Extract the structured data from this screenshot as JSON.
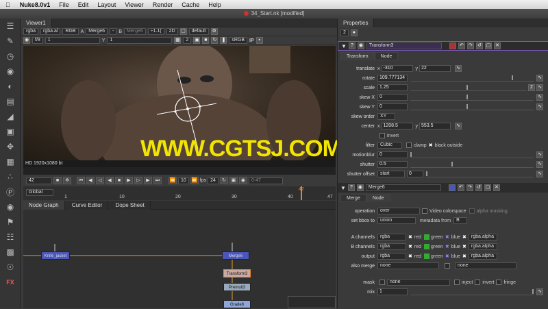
{
  "menubar": {
    "app": "Nuke8.0v1",
    "items": [
      "File",
      "Edit",
      "Layout",
      "Viewer",
      "Render",
      "Cache",
      "Help"
    ]
  },
  "window": {
    "title": "34_Start.nk [modified]"
  },
  "viewer": {
    "tab": "Viewer1",
    "channels": "rgba",
    "channel2": "rgba.al",
    "layer": "RGB",
    "a_label": "A",
    "a_input": "Merge6",
    "compare": "-",
    "b_label": "B",
    "b_input": "Merge6",
    "zoom": "÷1.1(",
    "view": "2D",
    "lut_default": "default",
    "fstop": "f/8",
    "gain": "1",
    "y_label": "Y",
    "gamma": "1",
    "proxy": "2",
    "colorspace": "sRGB",
    "ip": "IP",
    "format": "HD 1920x1080 bt",
    "frame": "42",
    "fps_label": "fps",
    "fps": "24",
    "step": "10",
    "range": "0-47",
    "frame_mark": "42",
    "tl_ticks": [
      "1",
      "10",
      "20",
      "30",
      "40",
      "47"
    ],
    "scope": "Global"
  },
  "watermark": "WWW.CGTSJ.COM",
  "graph": {
    "tabs": [
      "Node Graph",
      "Curve Editor",
      "Dope Sheet"
    ],
    "nodes": {
      "left": "Knife_jacket",
      "merge": "Merge6",
      "transform": "Transform3",
      "premult": "Premult3",
      "grade": "Grade8"
    }
  },
  "properties": {
    "title": "Properties",
    "count": "2",
    "transform": {
      "name": "Transform3",
      "tabs": [
        "Transform",
        "Node"
      ],
      "translate_label": "translate",
      "x_label": "x",
      "tx": "-310",
      "y_label": "y",
      "ty": "22",
      "rotate_label": "rotate",
      "rotate": "109.777134",
      "scale_label": "scale",
      "scale": "1.25",
      "scale_btn": "2",
      "skewx_label": "skew X",
      "skewx": "0",
      "skewy_label": "skew Y",
      "skewy": "0",
      "skeworder_label": "skew order",
      "skeworder": "XY",
      "center_label": "center",
      "cx": "1208.5",
      "cy": "553.5",
      "invert": "invert",
      "filter_label": "filter",
      "filter": "Cubic",
      "clamp": "clamp",
      "black_outside": "black outside",
      "motionblur_label": "motionblur",
      "motionblur": "0",
      "shutter_label": "shutter",
      "shutter": "0.5",
      "shutteroffset_label": "shutter offset",
      "shutteroffset": "start",
      "shutteroffset_val": "0"
    },
    "merge": {
      "name": "Merge6",
      "tabs": [
        "Merge",
        "Node"
      ],
      "operation_label": "operation",
      "operation": "over",
      "video_colorspace": "Video colorspace",
      "alpha_masking": "alpha masking",
      "bbox_label": "set bbox to",
      "bbox": "union",
      "metadata_label": "metadata from",
      "metadata": "B",
      "a_label": "A channels",
      "a": "rgba",
      "b_label": "B channels",
      "b": "rgba",
      "out_label": "output",
      "out": "rgba",
      "red": "red",
      "green": "green",
      "blue": "blue",
      "alpha_ch": "rgba.alpha",
      "also_label": "also merge",
      "also": "none",
      "also2": "none",
      "mask_label": "mask",
      "mask": "none",
      "inject": "inject",
      "invert": "invert",
      "fringe": "fringe",
      "mix_label": "mix",
      "mix": "1"
    }
  },
  "tools": [
    "layers-icon",
    "brush-icon",
    "clock-icon",
    "palette-icon",
    "circle-icon",
    "channel-icon",
    "filter-icon",
    "box-icon",
    "transform-icon",
    "cube-icon",
    "particle-icon",
    "d-icon",
    "eye-icon",
    "tag-icon",
    "list-icon",
    "grid-icon",
    "nuke-icon",
    "fx-icon"
  ]
}
